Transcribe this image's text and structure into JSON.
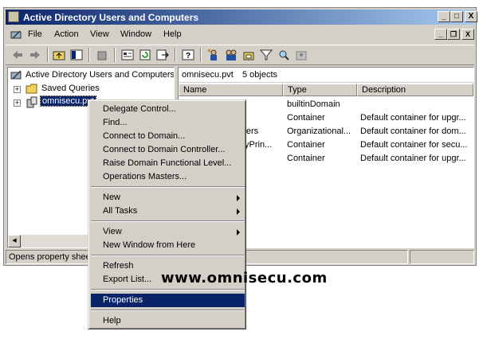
{
  "window": {
    "title": "Active Directory Users and Computers",
    "controls": {
      "minimize": "_",
      "maximize": "□",
      "close": "X"
    }
  },
  "menubar": {
    "items": [
      "File",
      "Action",
      "View",
      "Window",
      "Help"
    ],
    "mdi_controls": {
      "minimize": "_",
      "restore": "❐",
      "close": "X"
    }
  },
  "toolbar": {
    "buttons": [
      "back-icon",
      "forward-icon",
      "up-folder-icon",
      "show-tree-icon",
      "delete-icon",
      "properties-icon",
      "refresh-icon",
      "export-list-icon",
      "help-icon",
      "new-user-icon",
      "new-group-icon",
      "new-ou-icon",
      "filter-icon",
      "find-icon",
      "add-to-group-icon"
    ]
  },
  "tree": {
    "root": "Active Directory Users and Computers",
    "items": [
      {
        "label": "Saved Queries",
        "icon": "folder-icon"
      },
      {
        "label": "omnisecu.pvt",
        "icon": "domain-icon",
        "selected": true
      }
    ]
  },
  "right_pane": {
    "header_name": "omnisecu.pvt",
    "header_count": "5 objects",
    "columns": [
      "Name",
      "Type",
      "Description"
    ],
    "rows": [
      {
        "name": "",
        "type": "builtinDomain",
        "description": ""
      },
      {
        "name": "",
        "type": "Container",
        "description": "Default container for upgr..."
      },
      {
        "name": "llers",
        "type": "Organizational...",
        "description": "Default container for dom..."
      },
      {
        "name": "tyPrin...",
        "type": "Container",
        "description": "Default container for secu..."
      },
      {
        "name": "",
        "type": "Container",
        "description": "Default container for upgr..."
      }
    ]
  },
  "status": {
    "text": "Opens property shee"
  },
  "context_menu": {
    "group1": [
      "Delegate Control...",
      "Find...",
      "Connect to Domain...",
      "Connect to Domain Controller...",
      "Raise Domain Functional Level...",
      "Operations Masters..."
    ],
    "group2": [
      "New",
      "All Tasks"
    ],
    "group3": [
      "View",
      "New Window from Here"
    ],
    "group4": [
      "Refresh",
      "Export List..."
    ],
    "group5": [
      "Properties"
    ],
    "group6": [
      "Help"
    ]
  },
  "watermark": "www.omnisecu.com",
  "colors": {
    "title_start": "#0a246a",
    "title_end": "#a6caf0",
    "highlight": "#0a246a",
    "face": "#d4d0c8"
  }
}
